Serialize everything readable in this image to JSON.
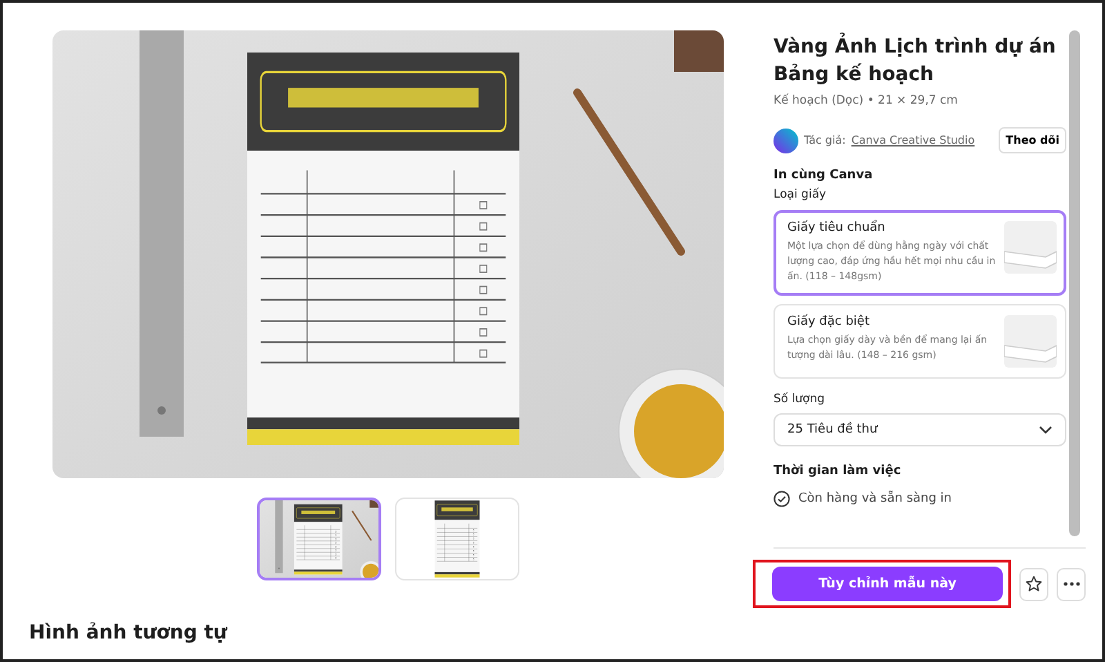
{
  "preview": {
    "thumbnails": [
      {
        "kind": "photo",
        "selected": true
      },
      {
        "kind": "template",
        "selected": false
      }
    ]
  },
  "details": {
    "title": "Vàng Ảnh Lịch trình dự án Bảng kế hoạch",
    "subtitle": "Kế hoạch (Dọc) • 21 × 29,7 cm",
    "author": {
      "label": "Tác giả:",
      "name": "Canva Creative Studio",
      "follow_button": "Theo dõi"
    },
    "print": {
      "heading": "In cùng Canva",
      "paper_label": "Loại giấy",
      "paper_options": [
        {
          "name": "Giấy tiêu chuẩn",
          "description": "Một lựa chọn để dùng hằng ngày với chất lượng cao, đáp ứng hầu hết mọi nhu cầu in ấn. (118 – 148gsm)",
          "selected": true
        },
        {
          "name": "Giấy đặc biệt",
          "description": "Lựa chọn giấy dày và bền để mang lại ấn tượng dài lâu. (148 – 216 gsm)",
          "selected": false
        }
      ],
      "quantity_label": "Số lượng",
      "quantity_value": "25 Tiêu đề thư",
      "time_heading": "Thời gian làm việc",
      "time_status": "Còn hàng và sẵn sàng in"
    },
    "actions": {
      "primary_button": "Tùy chỉnh mẫu này",
      "primary_highlighted": true
    }
  },
  "similar_heading": "Hình ảnh tương tự"
}
